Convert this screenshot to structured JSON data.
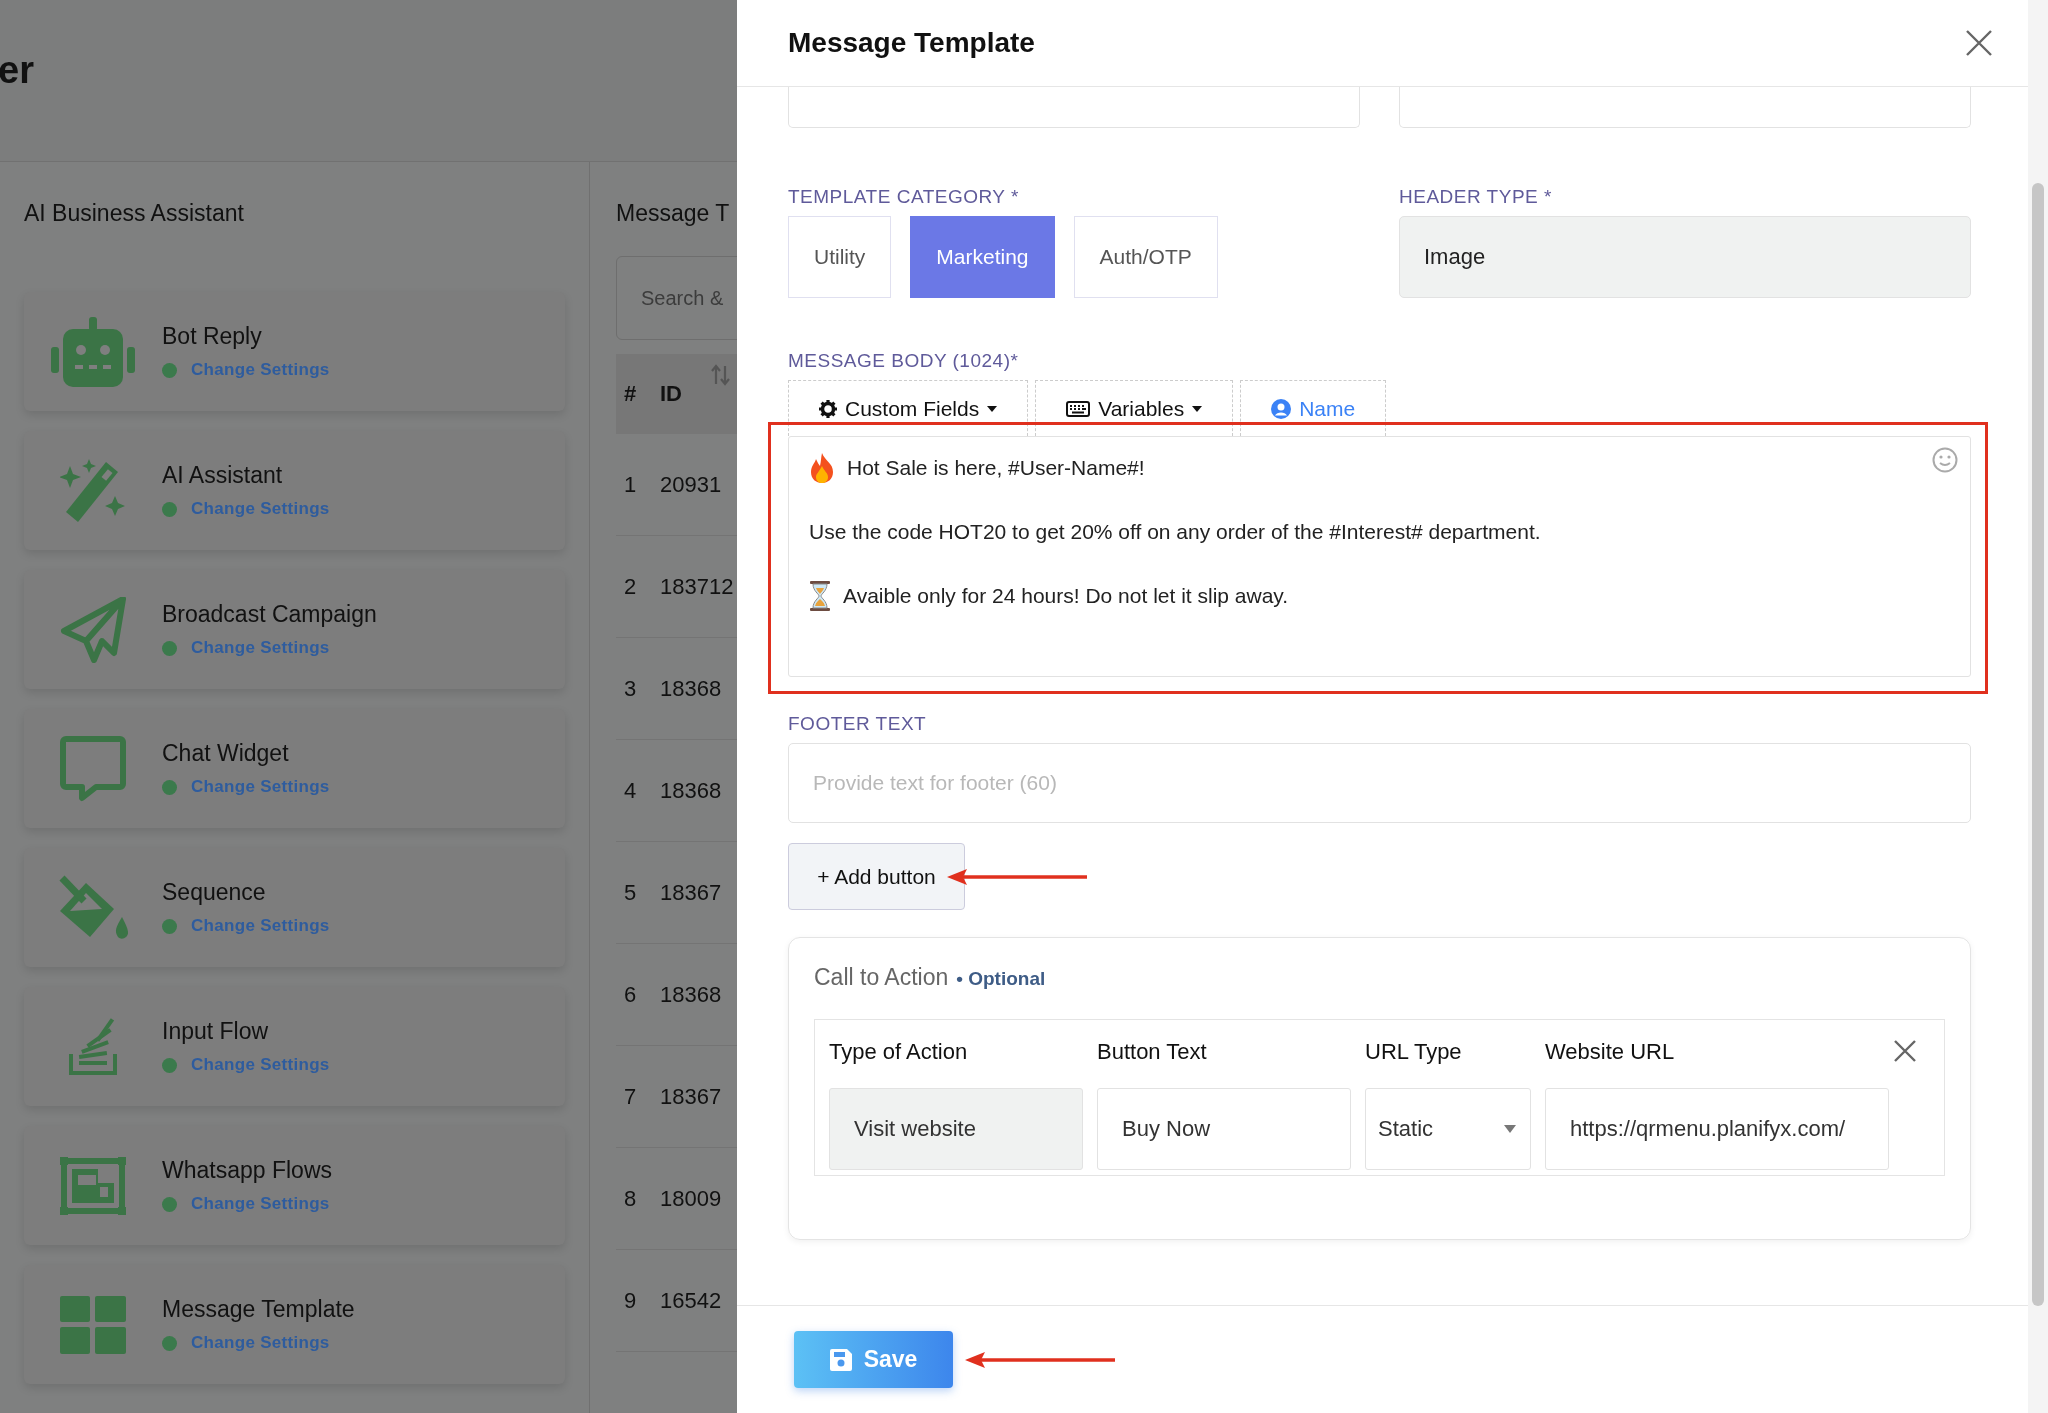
{
  "page": {
    "title_fragment": "er",
    "assistant_panel": {
      "title": "AI Business Assistant",
      "items": [
        {
          "name": "Bot Reply",
          "link": "Change Settings",
          "active": true
        },
        {
          "name": "AI Assistant",
          "link": "Change Settings",
          "active": true
        },
        {
          "name": "Broadcast Campaign",
          "link": "Change Settings",
          "active": true
        },
        {
          "name": "Chat Widget",
          "link": "Change Settings",
          "active": true
        },
        {
          "name": "Sequence",
          "link": "Change Settings",
          "active": true
        },
        {
          "name": "Input Flow",
          "link": "Change Settings",
          "active": true
        },
        {
          "name": "Whatsapp Flows",
          "link": "Change Settings",
          "active": true
        },
        {
          "name": "Message Template",
          "link": "Change Settings",
          "active": true
        }
      ]
    },
    "templates_panel": {
      "title_fragment": "Message T",
      "search_placeholder": "Search &",
      "columns": [
        "#",
        "ID"
      ],
      "rows": [
        {
          "index": "1",
          "id": "20931"
        },
        {
          "index": "2",
          "id": "183712"
        },
        {
          "index": "3",
          "id": "18368"
        },
        {
          "index": "4",
          "id": "18368"
        },
        {
          "index": "5",
          "id": "18367"
        },
        {
          "index": "6",
          "id": "18368"
        },
        {
          "index": "7",
          "id": "18367"
        },
        {
          "index": "8",
          "id": "18009"
        },
        {
          "index": "9",
          "id": "16542"
        }
      ]
    }
  },
  "modal": {
    "title": "Message Template",
    "template_category": {
      "label": "TEMPLATE CATEGORY *",
      "options": [
        {
          "label": "Utility",
          "selected": false
        },
        {
          "label": "Marketing",
          "selected": true
        },
        {
          "label": "Auth/OTP",
          "selected": false
        }
      ]
    },
    "header_type": {
      "label": "HEADER TYPE *",
      "value": "Image"
    },
    "message_body": {
      "label": "MESSAGE BODY (1024)*",
      "toolbar": [
        {
          "label": "Custom Fields",
          "kind": "dropdown"
        },
        {
          "label": "Variables",
          "kind": "dropdown"
        },
        {
          "label": "Name",
          "kind": "insert"
        }
      ],
      "lines": [
        "Hot Sale is here, #User-Name#!",
        "Use the code HOT20 to get 20% off on any order of the #Interest# department.",
        "Avaible only for 24 hours! Do not let it slip away."
      ]
    },
    "footer_text": {
      "label": "FOOTER TEXT",
      "placeholder": "Provide text for footer (60)"
    },
    "add_button": "+ Add button",
    "call_to_action": {
      "title": "Call to Action",
      "badge": "• Optional",
      "columns": [
        "Type of Action",
        "Button Text",
        "URL Type",
        "Website URL"
      ],
      "row": {
        "type_of_action": {
          "value": "Visit website",
          "readonly": true
        },
        "button_text": {
          "value": "Buy Now",
          "readonly": false
        },
        "url_type": "Static",
        "website_url": {
          "value": "https://qrmenu.planifyx.com/",
          "readonly": false
        }
      }
    },
    "save_button": "Save"
  }
}
